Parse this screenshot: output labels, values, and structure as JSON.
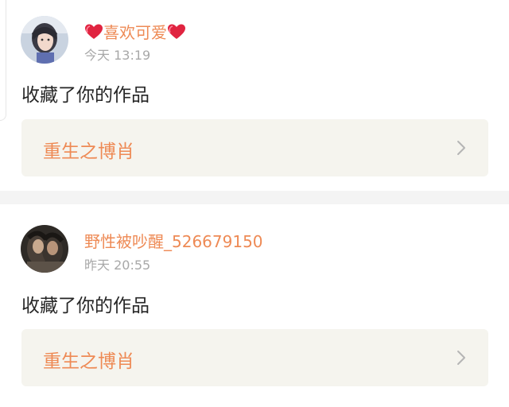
{
  "notifications": [
    {
      "user_name": "喜欢可爱",
      "heart_icon": "heart-icon",
      "timestamp": "今天 13:19",
      "action": "收藏了你的作品",
      "work_title": "重生之博肖",
      "avatar_icon": "avatar"
    },
    {
      "user_name": "野性被吵醒_526679150",
      "timestamp": "昨天 20:55",
      "action": "收藏了你的作品",
      "work_title": "重生之博肖",
      "avatar_icon": "avatar"
    }
  ],
  "colors": {
    "accent": "#ee8a55",
    "text": "#262626",
    "muted": "#a8a8a8",
    "link_bg": "#f5f4ee",
    "page_bg": "#f4f4f4",
    "heart": "#e02440"
  }
}
